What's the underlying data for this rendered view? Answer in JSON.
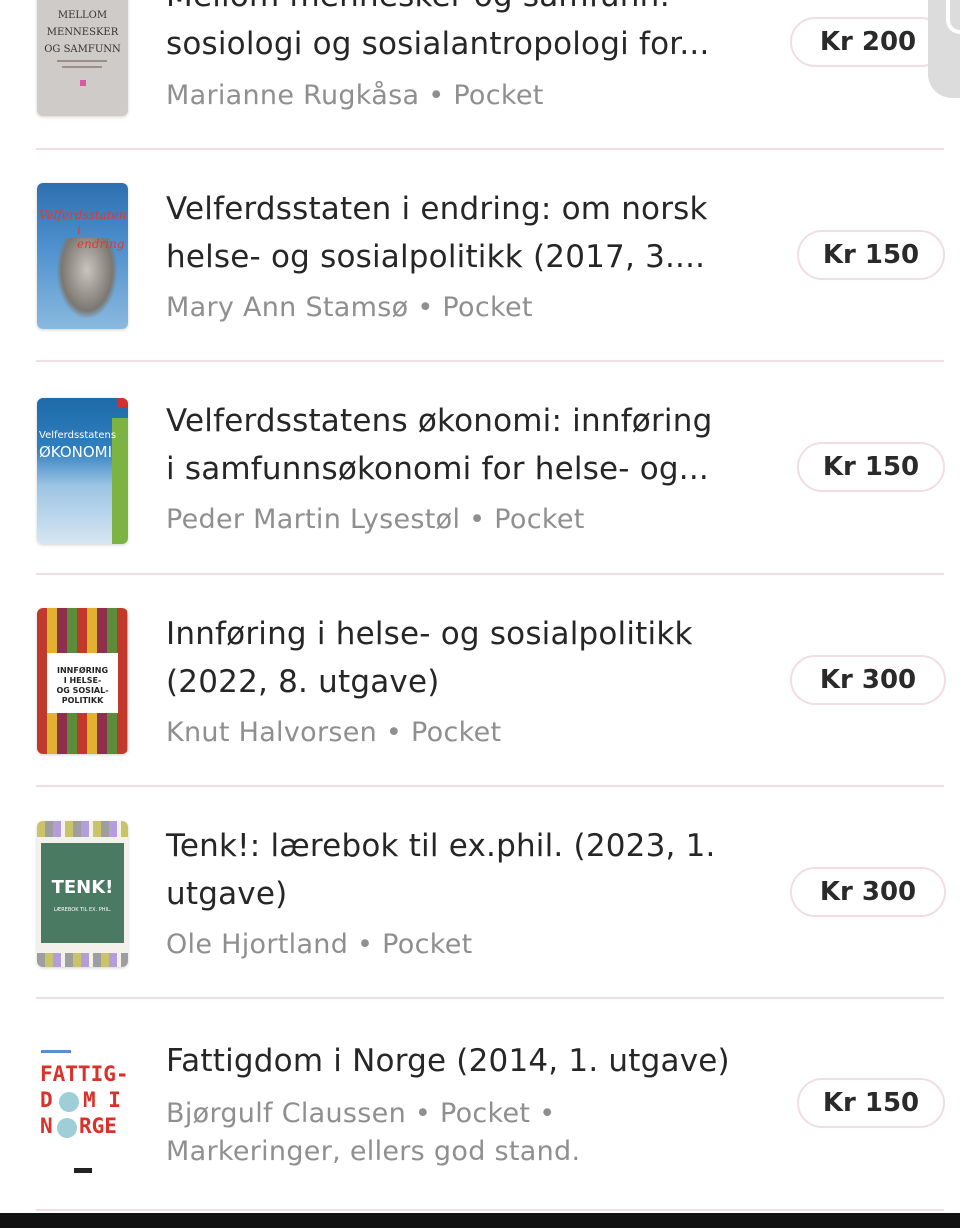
{
  "listings": [
    {
      "title": "Mellom mennesker og samfunn:\nsosiologi og sosialantropologi for...",
      "meta": "Marianne Rugkåsa • Pocket",
      "price": "Kr 200",
      "cover_lines": [
        "MELLOM",
        "MENNESKER",
        "OG SAMFUNN"
      ]
    },
    {
      "title": "Velferdsstaten i endring: om norsk\nhelse- og sosialpolitikk (2017, 3....",
      "meta": "Mary Ann Stamsø • Pocket",
      "price": "Kr 150",
      "cover_lines": [
        "Velferdsstaten",
        "i endring"
      ]
    },
    {
      "title": "Velferdsstatens økonomi: innføring\ni samfunnsøkonomi for helse- og...",
      "meta": "Peder Martin Lysestøl • Pocket",
      "price": "Kr 150",
      "cover_lines": [
        "Velferdsstatens",
        "ØKONOMI"
      ]
    },
    {
      "title": "Innføring i helse- og sosialpolitikk\n(2022, 8. utgave)",
      "meta": "Knut Halvorsen • Pocket",
      "price": "Kr 300",
      "cover_lines": [
        "INNFØRING",
        "I HELSE-",
        "OG SOSIAL-",
        "POLITIKK"
      ]
    },
    {
      "title": "Tenk!: lærebok til ex.phil. (2023, 1.\nutgave)",
      "meta": "Ole Hjortland • Pocket",
      "price": "Kr 300",
      "cover_lines": [
        "TENK!",
        "LÆREBOK TIL EX. PHIL."
      ]
    },
    {
      "title": "Fattigdom i Norge (2014, 1. utgave)",
      "meta": "Bjørgulf Claussen • Pocket •\nMarkeringer, ellers god stand.",
      "price": "Kr 150",
      "cover_lines": [
        "FATTIG-",
        "D",
        "M I",
        "N",
        "RGE"
      ]
    }
  ],
  "colors": {
    "divider": "#f1dde3",
    "price_border": "#f2dde3",
    "meta_text": "#8f8f8f",
    "fattigdom_red": "#d8322a"
  }
}
